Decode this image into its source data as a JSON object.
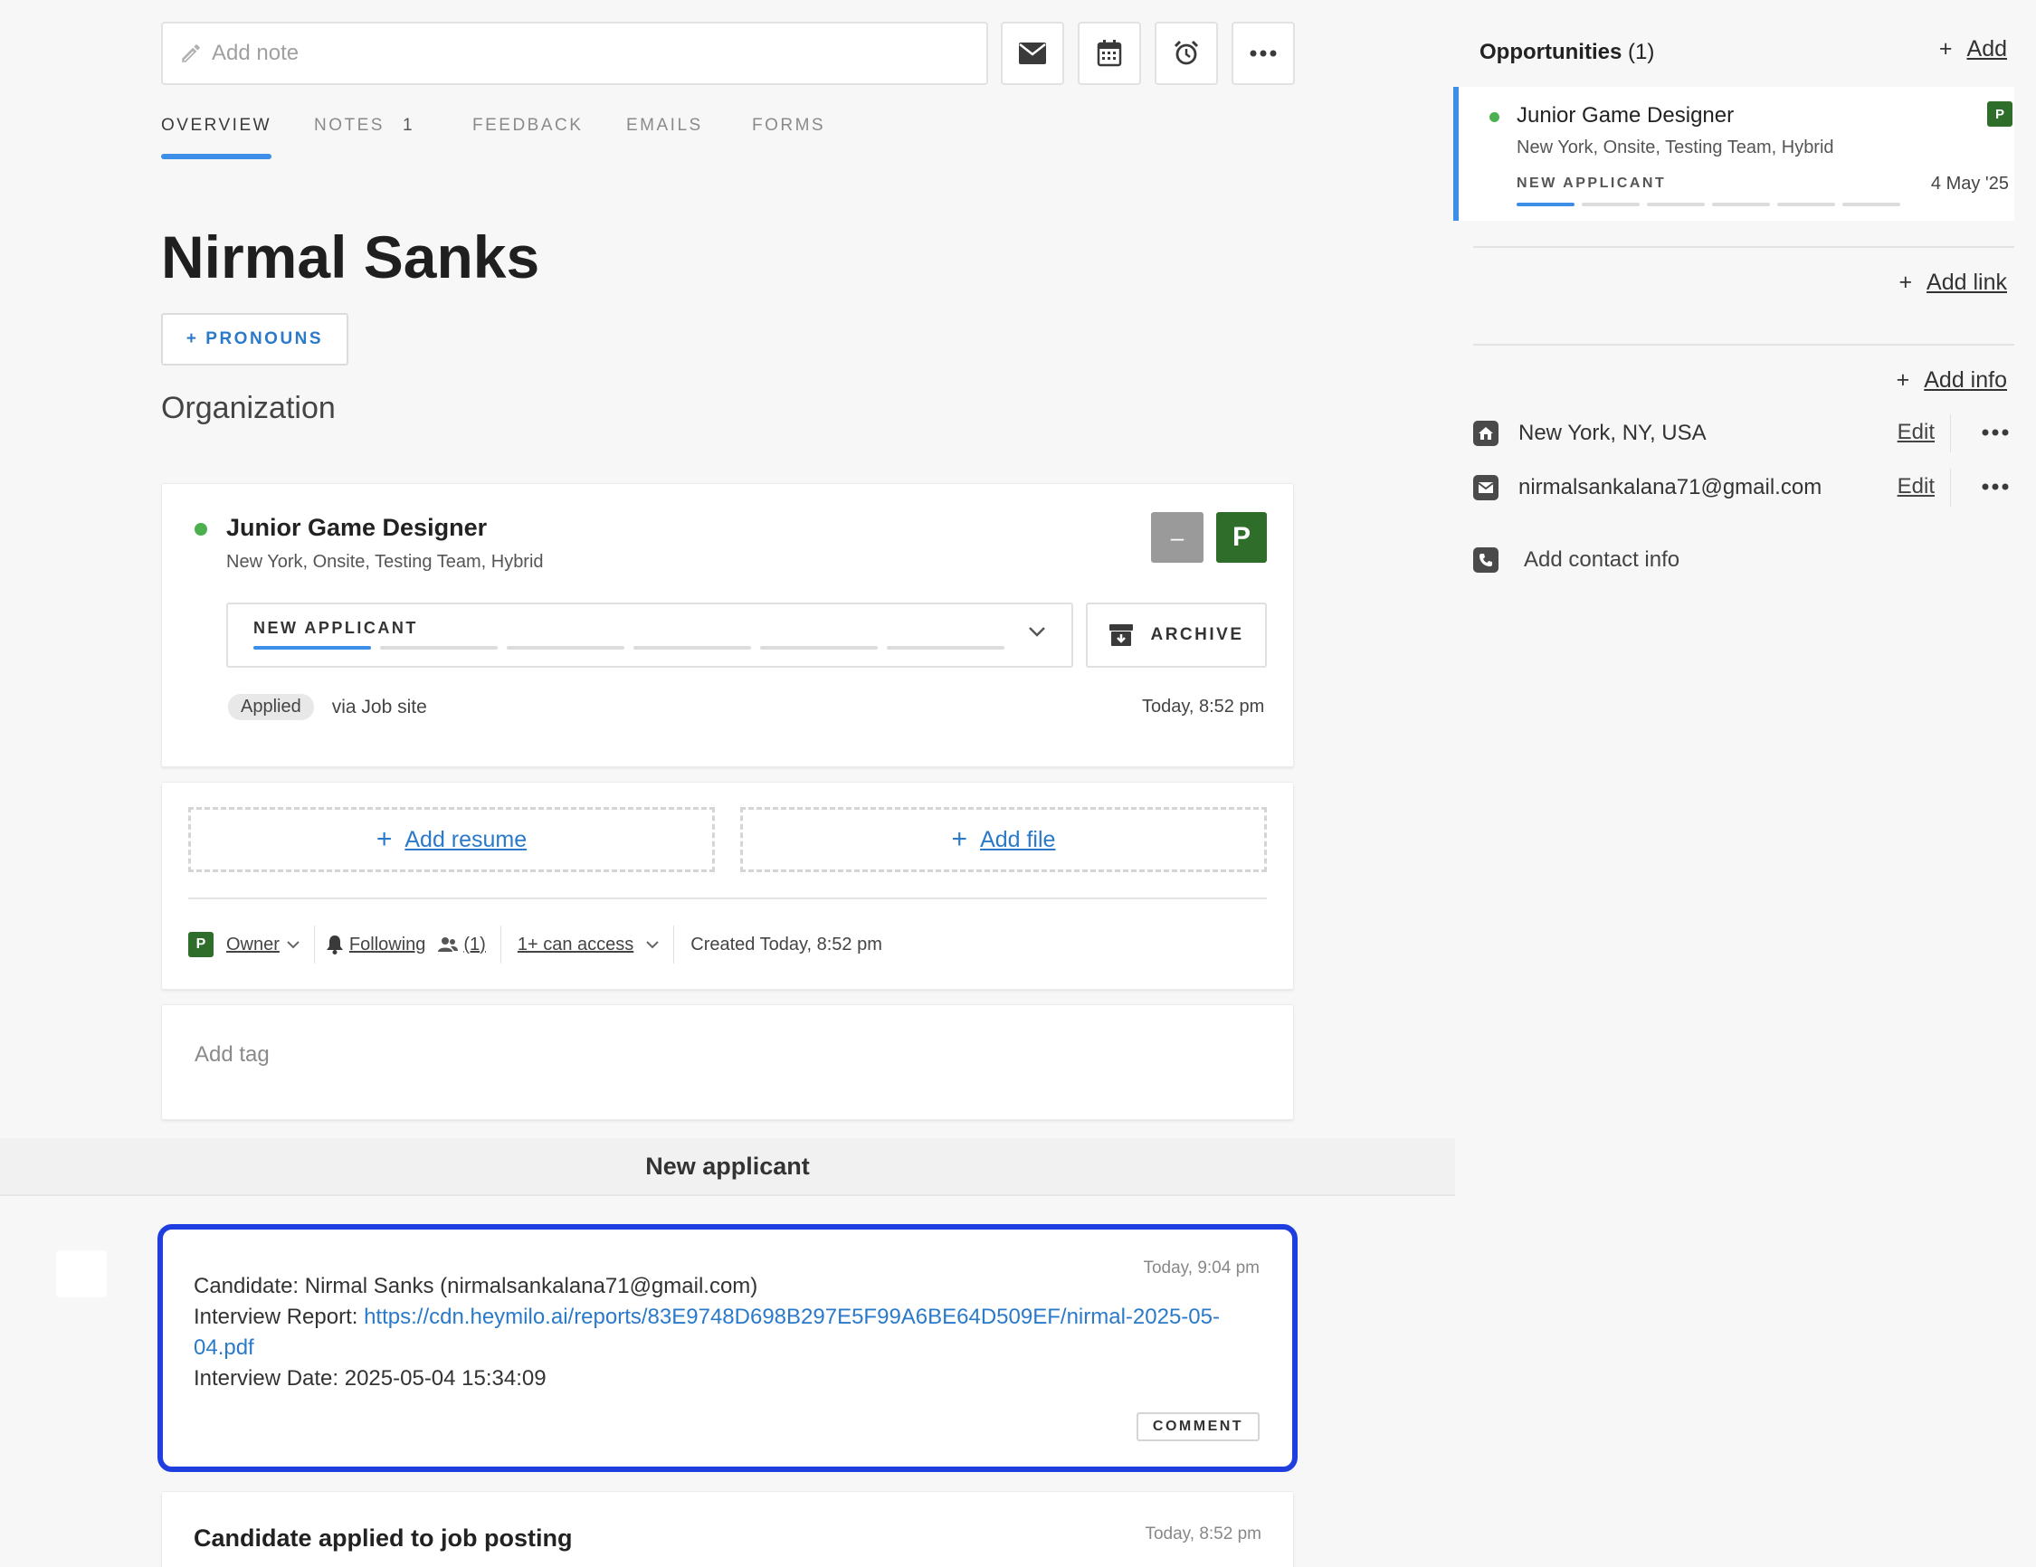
{
  "toolbar": {
    "note_placeholder": "Add note",
    "icons": [
      "pencil-icon",
      "mail-icon",
      "calendar-icon",
      "alarm-icon",
      "more-icon"
    ]
  },
  "tabs": [
    {
      "label": "OVERVIEW",
      "active": true
    },
    {
      "label": "NOTES",
      "count": "1"
    },
    {
      "label": "FEEDBACK"
    },
    {
      "label": "EMAILS"
    },
    {
      "label": "FORMS"
    }
  ],
  "candidate": {
    "name": "Nirmal Sanks",
    "pronouns_label": "+ PRONOUNS",
    "organization_label": "Organization"
  },
  "opportunity_card": {
    "title": "Junior Game Designer",
    "meta": "New York, Onsite, Testing Team, Hybrid",
    "owner_initial": "P",
    "minimize_label": "–",
    "stage": "NEW APPLICANT",
    "stage_progress": "1 of 6",
    "archive_label": "ARCHIVE",
    "source_badge": "Applied",
    "source_text": "via Job site",
    "timestamp": "Today, 8:52 pm"
  },
  "files": {
    "add_resume": "Add resume",
    "add_file": "Add file"
  },
  "meta_row": {
    "owner_initial": "P",
    "owner_label": "Owner",
    "following_label": "Following",
    "followers_count": "(1)",
    "access_label": "1+ can access",
    "created": "Created Today, 8:52 pm"
  },
  "tags": {
    "placeholder": "Add tag"
  },
  "timeline": {
    "section_title": "New applicant",
    "note": {
      "timestamp": "Today, 9:04 pm",
      "line1": "Candidate: Nirmal Sanks (nirmalsankalana71@gmail.com)",
      "line2_label": "Interview Report: ",
      "line2_link_a": "https://cdn.heymilo.ai/reports/83E9748D698B297E5F99A6BE64D509EF/nirmal-2025-05-",
      "line2_link_b": "04.pdf",
      "line3": "Interview Date: 2025-05-04 15:34:09",
      "comment_label": "COMMENT"
    },
    "event": {
      "title": "Candidate applied to job posting",
      "timestamp": "Today, 8:52 pm"
    }
  },
  "right_panel": {
    "opportunities_title": "Opportunities",
    "opportunities_count": "(1)",
    "add_label": "Add",
    "opportunity": {
      "title": "Junior Game Designer",
      "meta": "New York, Onsite, Testing Team, Hybrid",
      "stage": "NEW APPLICANT",
      "date": "4 May '25",
      "owner_initial": "P"
    },
    "add_link_label": "Add link",
    "add_info_label": "Add info",
    "location": "New York, NY, USA",
    "email": "nirmalsankalana71@gmail.com",
    "edit_label": "Edit",
    "add_contact_label": "Add contact info"
  },
  "colors": {
    "accent_blue": "#3d8ee6",
    "link_blue": "#2a7ac9",
    "owner_green": "#2f6d2a",
    "status_dot": "#4caf50",
    "highlight_border": "#1f3ee0"
  }
}
